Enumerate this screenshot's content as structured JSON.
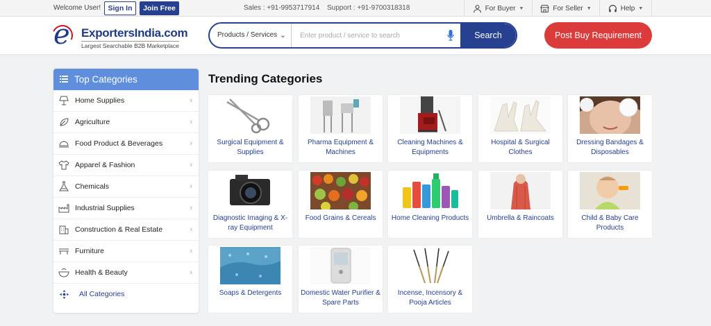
{
  "topbar": {
    "welcome": "Welcome User!",
    "sign_in": "Sign In",
    "join_free": "Join Free",
    "sales": "Sales : +91-9953717914",
    "support": "Support : +91-9700318318",
    "for_buyer": "For Buyer",
    "for_seller": "For Seller",
    "help": "Help"
  },
  "header": {
    "logo_name": "ExportersIndia.com",
    "logo_tagline": "Largest Searchable B2B Marketplace",
    "search_category": "Products / Services",
    "search_placeholder": "Enter product / service to search",
    "search_button": "Search",
    "post_button": "Post Buy Requirement"
  },
  "sidebar": {
    "title": "Top Categories",
    "items": [
      {
        "label": "Home Supplies",
        "icon": "lamp-icon"
      },
      {
        "label": "Agriculture",
        "icon": "leaf-icon"
      },
      {
        "label": "Food Product & Beverages",
        "icon": "food-cover-icon"
      },
      {
        "label": "Apparel & Fashion",
        "icon": "shirt-icon"
      },
      {
        "label": "Chemicals",
        "icon": "flask-icon"
      },
      {
        "label": "Industrial Supplies",
        "icon": "factory-icon"
      },
      {
        "label": "Construction & Real Estate",
        "icon": "building-icon"
      },
      {
        "label": "Furniture",
        "icon": "bench-icon"
      },
      {
        "label": "Health & Beauty",
        "icon": "bowl-icon"
      }
    ],
    "all_label": "All Categories"
  },
  "trending": {
    "title": "Trending Categories",
    "cards": [
      {
        "label": "Surgical Equipment & Supplies"
      },
      {
        "label": "Pharma Equipment & Machines"
      },
      {
        "label": "Cleaning Machines & Equipments"
      },
      {
        "label": "Hospital & Surgical Clothes"
      },
      {
        "label": "Dressing Bandages & Disposables"
      },
      {
        "label": "Diagnostic Imaging & X-ray Equipment"
      },
      {
        "label": "Food Grains & Cereals"
      },
      {
        "label": "Home Cleaning Products"
      },
      {
        "label": "Umbrella & Raincoats"
      },
      {
        "label": "Child & Baby Care Products"
      },
      {
        "label": "Soaps & Detergents"
      },
      {
        "label": "Domestic Water Purifier & Spare Parts"
      },
      {
        "label": "Incense, Incensory & Pooja Articles"
      }
    ]
  },
  "colors": {
    "brand_blue": "#27408f",
    "accent_red": "#dc3b3b",
    "sidebar_head": "#5f8fdc"
  }
}
